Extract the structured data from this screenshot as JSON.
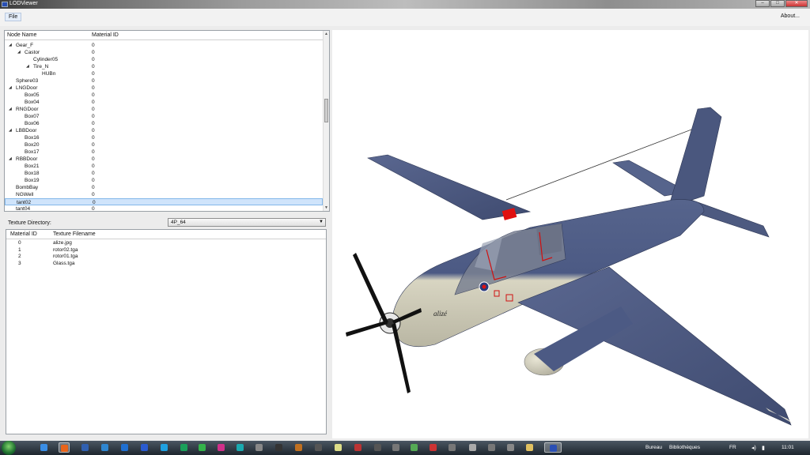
{
  "window": {
    "title": "LODViewer",
    "controls": {
      "minimize": "–",
      "maximize": "□",
      "close": "✕"
    }
  },
  "menu": {
    "file": "File",
    "about": "About..."
  },
  "tree": {
    "columns": {
      "node_name": "Node Name",
      "material_id": "Material ID"
    },
    "rows": [
      {
        "label": "Gear_F",
        "material_id": "0",
        "expander": "◢"
      },
      {
        "label": "Castor",
        "material_id": "0",
        "expander": "◢"
      },
      {
        "label": "Cylinder05",
        "material_id": "0",
        "expander": ""
      },
      {
        "label": "Tire_N",
        "material_id": "0",
        "expander": "◢"
      },
      {
        "label": "HUBn",
        "material_id": "0",
        "expander": ""
      },
      {
        "label": "Sphere03",
        "material_id": "0",
        "expander": ""
      },
      {
        "label": "LNGDoor",
        "material_id": "0",
        "expander": "◢"
      },
      {
        "label": "Box05",
        "material_id": "0",
        "expander": ""
      },
      {
        "label": "Box04",
        "material_id": "0",
        "expander": ""
      },
      {
        "label": "RNGDoor",
        "material_id": "0",
        "expander": "◢"
      },
      {
        "label": "Box07",
        "material_id": "0",
        "expander": ""
      },
      {
        "label": "Box06",
        "material_id": "0",
        "expander": ""
      },
      {
        "label": "LBBDoor",
        "material_id": "0",
        "expander": "◢"
      },
      {
        "label": "Box16",
        "material_id": "0",
        "expander": ""
      },
      {
        "label": "Box20",
        "material_id": "0",
        "expander": ""
      },
      {
        "label": "Box17",
        "material_id": "0",
        "expander": ""
      },
      {
        "label": "RBBDoor",
        "material_id": "0",
        "expander": "◢"
      },
      {
        "label": "Box21",
        "material_id": "0",
        "expander": ""
      },
      {
        "label": "Box18",
        "material_id": "0",
        "expander": ""
      },
      {
        "label": "Box19",
        "material_id": "0",
        "expander": ""
      },
      {
        "label": "BombBay",
        "material_id": "0",
        "expander": ""
      },
      {
        "label": "NGWell",
        "material_id": "0",
        "expander": ""
      },
      {
        "label": "tant02",
        "material_id": "0",
        "expander": "",
        "selected": true
      },
      {
        "label": "tant04",
        "material_id": "0",
        "expander": ""
      }
    ]
  },
  "texture_directory": {
    "label": "Texture Directory:",
    "value": "4P_64",
    "chevron": "▼"
  },
  "textures": {
    "columns": {
      "material_id": "Material ID",
      "filename": "Texture Filename"
    },
    "rows": [
      {
        "id": "0",
        "file": "alize.jpg"
      },
      {
        "id": "1",
        "file": "rotor02.tga"
      },
      {
        "id": "2",
        "file": "rotor01.tga"
      },
      {
        "id": "3",
        "file": "Glass.tga"
      }
    ]
  },
  "viewport": {
    "model_colors": {
      "upper": "#4c5a84",
      "lower": "#d4d1bd",
      "accent": "#e01010"
    },
    "fuselage_text": "alizé"
  },
  "taskbar": {
    "icons": [
      "explorer-icon",
      "firefox-icon",
      "app-icon",
      "download-icon",
      "edge-icon",
      "app-icon",
      "skype-icon",
      "app-icon",
      "app-icon",
      "app-icon",
      "app-icon",
      "app-icon",
      "app-icon",
      "app-icon",
      "app-icon",
      "app-icon",
      "app-icon",
      "app-icon",
      "app-icon",
      "app-icon",
      "app-icon",
      "app-icon",
      "app-icon",
      "app-icon",
      "app-icon",
      "folder-icon",
      "lodviewer-icon"
    ],
    "bureau": "Bureau",
    "libraries": "Bibliothèques",
    "language": "FR",
    "clock": "11:01"
  }
}
